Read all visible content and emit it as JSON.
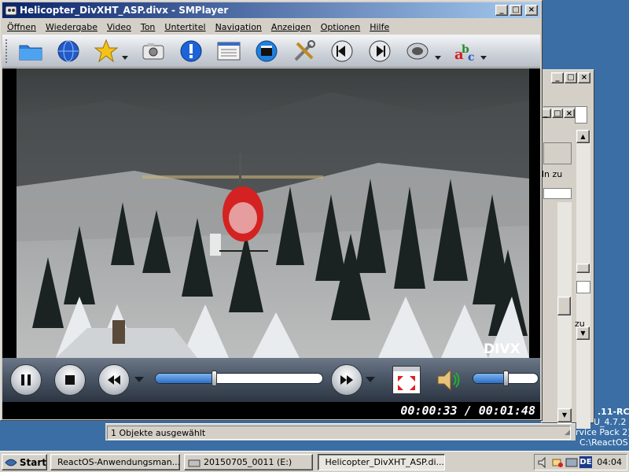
{
  "window": {
    "title": "Helicopter_DivXHT_ASP.divx - SMPlayer"
  },
  "menu": [
    "Öffnen",
    "Wiedergabe",
    "Video",
    "Ton",
    "Untertitel",
    "Navigation",
    "Anzeigen",
    "Optionen",
    "Hilfe"
  ],
  "toolbar": {
    "icons": [
      "folder-icon",
      "globe-icon",
      "star-favorites-icon",
      "camera-screenshot-icon",
      "info-icon",
      "playlist-icon",
      "clapperboard-icon",
      "tools-icon",
      "previous-icon",
      "next-icon",
      "audio-menu-icon",
      "subtitles-abc-icon"
    ]
  },
  "video": {
    "watermark": "DIVX"
  },
  "playback": {
    "progress": 0.35,
    "volume": 0.5,
    "time": "00:00:33 / 00:01:48"
  },
  "background_window": {
    "status": "1 Objekte ausgewählt",
    "partial_text_1": "ln zu",
    "partial_text_2": "zu"
  },
  "desktop_text": {
    "line1": ".11-RC",
    "line2": "U_4.7.2",
    "line3": "rvice Pack 2)",
    "line4": "C:\\ReactOS"
  },
  "taskbar": {
    "start_label": "Start",
    "tasks": [
      {
        "label": "ReactOS-Anwendungsman...",
        "active": false
      },
      {
        "label": "20150705_0011 (E:)",
        "active": false
      },
      {
        "label": "Helicopter_DivXHT_ASP.di...",
        "active": true
      }
    ],
    "language": "DE",
    "clock": "04:04"
  },
  "colors": {
    "titlebar_start": "#0a246a",
    "titlebar_end": "#a6caf0",
    "desktop": "#3a6ea5",
    "face": "#d4d0c8",
    "slider_fill": "#2f6fc4"
  }
}
